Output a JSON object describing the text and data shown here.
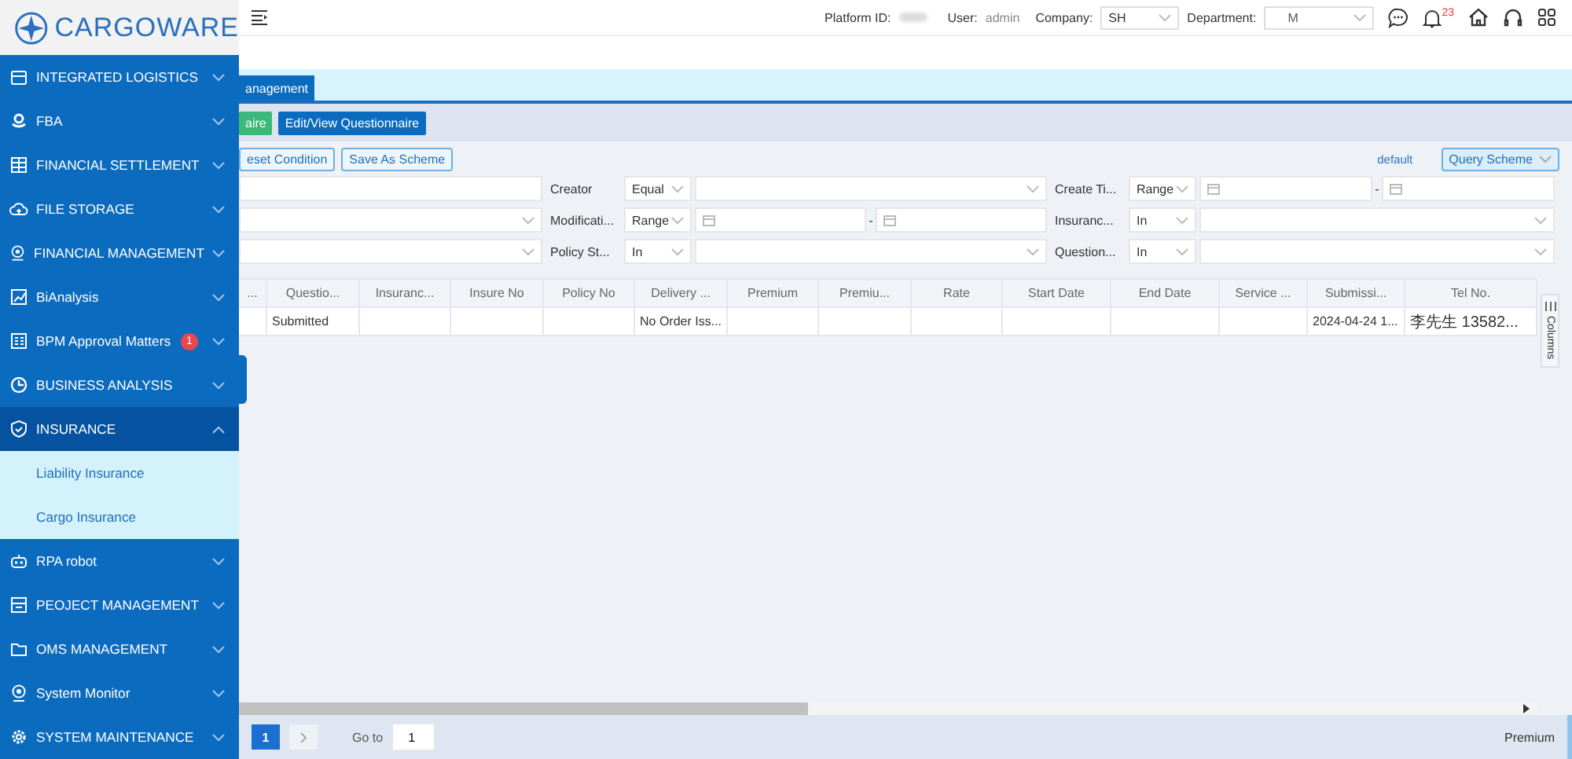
{
  "brand": "CARGOWARE",
  "sidebar": {
    "items": [
      {
        "label": "INTEGRATED LOGISTICS",
        "expanded": false,
        "selected": false
      },
      {
        "label": "FBA",
        "expanded": false,
        "selected": false
      },
      {
        "label": "FINANCIAL SETTLEMENT",
        "expanded": false,
        "selected": false
      },
      {
        "label": "FILE STORAGE",
        "expanded": false,
        "selected": false
      },
      {
        "label": "FINANCIAL MANAGEMENT",
        "expanded": false,
        "selected": false
      },
      {
        "label": "BiAnalysis",
        "expanded": false,
        "selected": false
      },
      {
        "label": "BPM Approval Matters",
        "expanded": false,
        "selected": false,
        "badge": "1"
      },
      {
        "label": "BUSINESS ANALYSIS",
        "expanded": false,
        "selected": false
      },
      {
        "label": "INSURANCE",
        "expanded": true,
        "selected": true,
        "children": [
          {
            "label": "Liability Insurance"
          },
          {
            "label": "Cargo Insurance"
          }
        ]
      },
      {
        "label": "RPA robot",
        "expanded": false,
        "selected": false
      },
      {
        "label": "PEOJECT MANAGEMENT",
        "expanded": false,
        "selected": false
      },
      {
        "label": "OMS MANAGEMENT",
        "expanded": false,
        "selected": false
      },
      {
        "label": "System Monitor",
        "expanded": false,
        "selected": false
      },
      {
        "label": "SYSTEM MAINTENANCE",
        "expanded": false,
        "selected": false
      }
    ]
  },
  "header": {
    "platform_label": "Platform ID:",
    "user_label": "User:",
    "user": "admin",
    "company_label": "Company:",
    "company": "SH",
    "department_label": "Department:",
    "department": "M",
    "notification_count": "23"
  },
  "tabs": [
    {
      "label": "anagement",
      "selected": true
    }
  ],
  "toolbar": [
    {
      "label": "aire",
      "kind": "success"
    },
    {
      "label": "Edit/View Questionnaire",
      "kind": "primary"
    }
  ],
  "filter": {
    "buttons": [
      "eset Condition",
      "Save As Scheme"
    ],
    "scheme": "default",
    "query_scheme": "Query Scheme",
    "rows": [
      [
        {
          "kind": "input"
        },
        {
          "kind": "label",
          "text": "Creator"
        },
        {
          "kind": "op",
          "text": "Equal"
        },
        {
          "kind": "select"
        },
        {
          "kind": "label",
          "text": "Create Ti..."
        },
        {
          "kind": "op",
          "text": "Range"
        },
        {
          "kind": "dates",
          "separator": "-"
        }
      ],
      [
        {
          "kind": "select"
        },
        {
          "kind": "label",
          "text": "Modificati..."
        },
        {
          "kind": "op",
          "text": "Range"
        },
        {
          "kind": "dates",
          "separator": "-"
        },
        {
          "kind": "label",
          "text": "Insuranc..."
        },
        {
          "kind": "op",
          "text": "In"
        },
        {
          "kind": "select"
        }
      ],
      [
        {
          "kind": "select"
        },
        {
          "kind": "label",
          "text": "Policy St..."
        },
        {
          "kind": "op",
          "text": "In"
        },
        {
          "kind": "select"
        },
        {
          "kind": "label",
          "text": "Question..."
        },
        {
          "kind": "op",
          "text": "In"
        },
        {
          "kind": "select"
        }
      ]
    ]
  },
  "table": {
    "columns": [
      "...",
      "Questio...",
      "Insuranc...",
      "Insure No",
      "Policy No",
      "Delivery ...",
      "Premium",
      "Premiu...",
      "Rate",
      "Start Date",
      "End Date",
      "Service ...",
      "Submissi...",
      "Tel No."
    ],
    "rows": [
      [
        "",
        "Submitted",
        "",
        "",
        "",
        "No Order Iss...",
        "",
        "",
        "",
        "",
        "",
        "",
        "2024-04-24 1...",
        "李先生 13582..."
      ]
    ],
    "columns_tab": "Columns"
  },
  "pagination": {
    "pages": [
      {
        "label": "1",
        "selected": true
      }
    ],
    "next_disabled": true,
    "goto_label": "Go to",
    "goto": "1"
  },
  "footer_right": "Premium"
}
